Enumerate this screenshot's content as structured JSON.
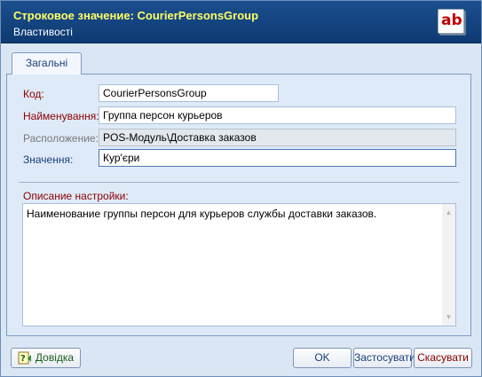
{
  "window": {
    "title": "Строковое значение:  CourierPersonsGroup",
    "subtitle": "Властивості",
    "icon": "ab-string-icon",
    "icon_text": "ab"
  },
  "tabs": [
    {
      "label": "Загальні",
      "active": true
    }
  ],
  "form": {
    "code": {
      "label": "Код:",
      "value": "CourierPersonsGroup"
    },
    "name": {
      "label": "Найменування:",
      "value": "Группа персон курьеров"
    },
    "location": {
      "label": "Расположение:",
      "value": "POS-Модуль\\Доставка заказов"
    },
    "value": {
      "label": "Значення:",
      "value": "Кур'єри"
    }
  },
  "description": {
    "label": "Описание настройки:",
    "text": "Наименование группы персон для курьеров службы доставки заказов."
  },
  "buttons": {
    "help": "Довідка",
    "ok": "OK",
    "apply": "Застосувати",
    "cancel": "Скасувати"
  },
  "colors": {
    "header_bg": "#0e3a72",
    "title": "#ffff66",
    "required_label": "#8b0000",
    "accent": "#1a3e7a"
  }
}
